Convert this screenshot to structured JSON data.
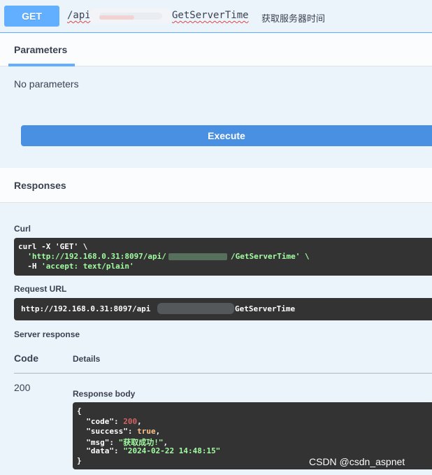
{
  "operation": {
    "method": "GET",
    "path_prefix": "/api",
    "path_suffix": "GetServerTime",
    "summary": "获取服务器时间"
  },
  "parameters": {
    "tab_label": "Parameters",
    "empty_text": "No parameters",
    "execute_label": "Execute"
  },
  "responses": {
    "title": "Responses",
    "curl_label": "Curl",
    "curl": {
      "line1": "curl -X 'GET' \\",
      "line2_prefix": "  'http://192.168.0.31:8097/api/",
      "line2_suffix": "/GetServerTime' \\",
      "line3_prefix": "  -H ",
      "line3_str": "'accept: text/plain'"
    },
    "request_url_label": "Request URL",
    "request_url_prefix": "http://192.168.0.31:8097/api",
    "request_url_suffix": "GetServerTime",
    "server_response_label": "Server response",
    "col_code": "Code",
    "col_details": "Details",
    "status_code": "200",
    "response_body_label": "Response body",
    "body": {
      "open": "{",
      "code_key": "  \"code\": ",
      "code_val": "200",
      "success_key": "  \"success\": ",
      "success_val": "true",
      "msg_key": "  \"msg\": ",
      "msg_val": "\"获取成功!\"",
      "data_key": "  \"data\": ",
      "data_val": "\"2024-02-22 14:48:15\"",
      "close": "}"
    }
  },
  "watermark": "CSDN @csdn_aspnet",
  "colors": {
    "get_accent": "#61affe",
    "execute": "#4990e2",
    "code_bg": "#333333",
    "string_green": "#a2fca2"
  }
}
